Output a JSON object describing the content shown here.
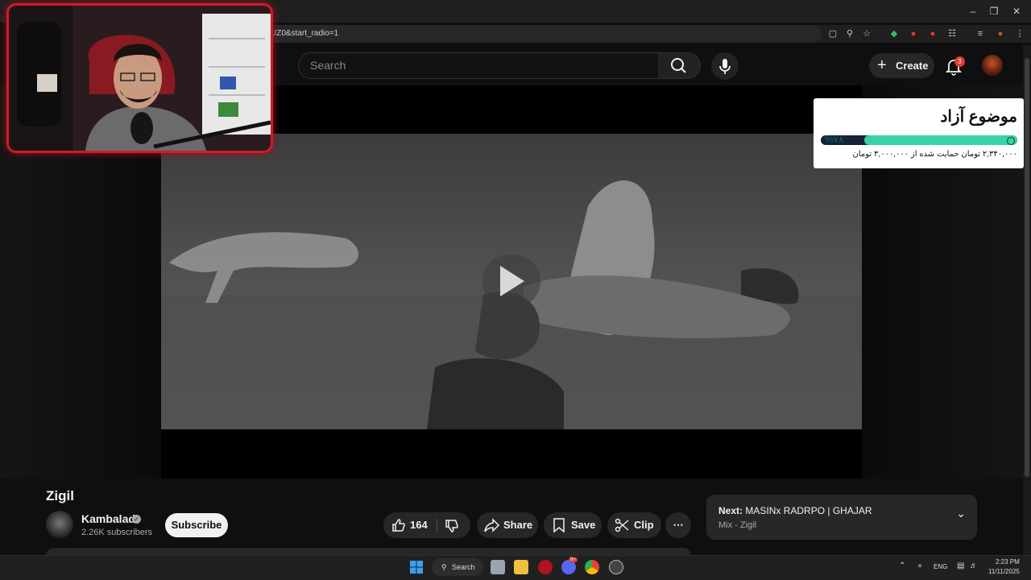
{
  "browser": {
    "url_fragment": "UZ0&start_radio=1",
    "window_controls": [
      "minimize-icon",
      "restore-icon",
      "close-icon"
    ],
    "extension_icons": [
      "cast-icon",
      "zoom-icon",
      "bookmark-star-icon",
      "shield-extension-icon",
      "red-extension-icon",
      "red-extension-icon-2",
      "puzzle-icon",
      "media-controls-icon",
      "profile-icon",
      "menu-dots-icon"
    ]
  },
  "header": {
    "search_placeholder": "Search",
    "create_label": "Create",
    "notification_count": "3"
  },
  "donation": {
    "title": "موضوع آزاد",
    "percent": "%۷۸",
    "progress": 0.78,
    "subtitle": "۲,۳۴۰,۰۰۰ تومان حمایت شده از ۳,۰۰۰,۰۰۰ تومان"
  },
  "video": {
    "title": "Zigil",
    "channel": "Kambalad",
    "subscribers": "2.26K subscribers",
    "subscribe_label": "Subscribe",
    "likes": "164",
    "share_label": "Share",
    "save_label": "Save",
    "clip_label": "Clip"
  },
  "next": {
    "prefix": "Next:",
    "title": "MASINx RADRPO | GHAJAR",
    "subtitle": "Mix - Zigil"
  },
  "taskbar": {
    "search_label": "Search",
    "language": "ENG",
    "time": "2:23 PM",
    "date": "11/11/2025",
    "discord_badge": "9+"
  },
  "colors": {
    "accent_red": "#d21a2a",
    "donation_green": "#39d2a6",
    "background": "#0f0f0f"
  }
}
